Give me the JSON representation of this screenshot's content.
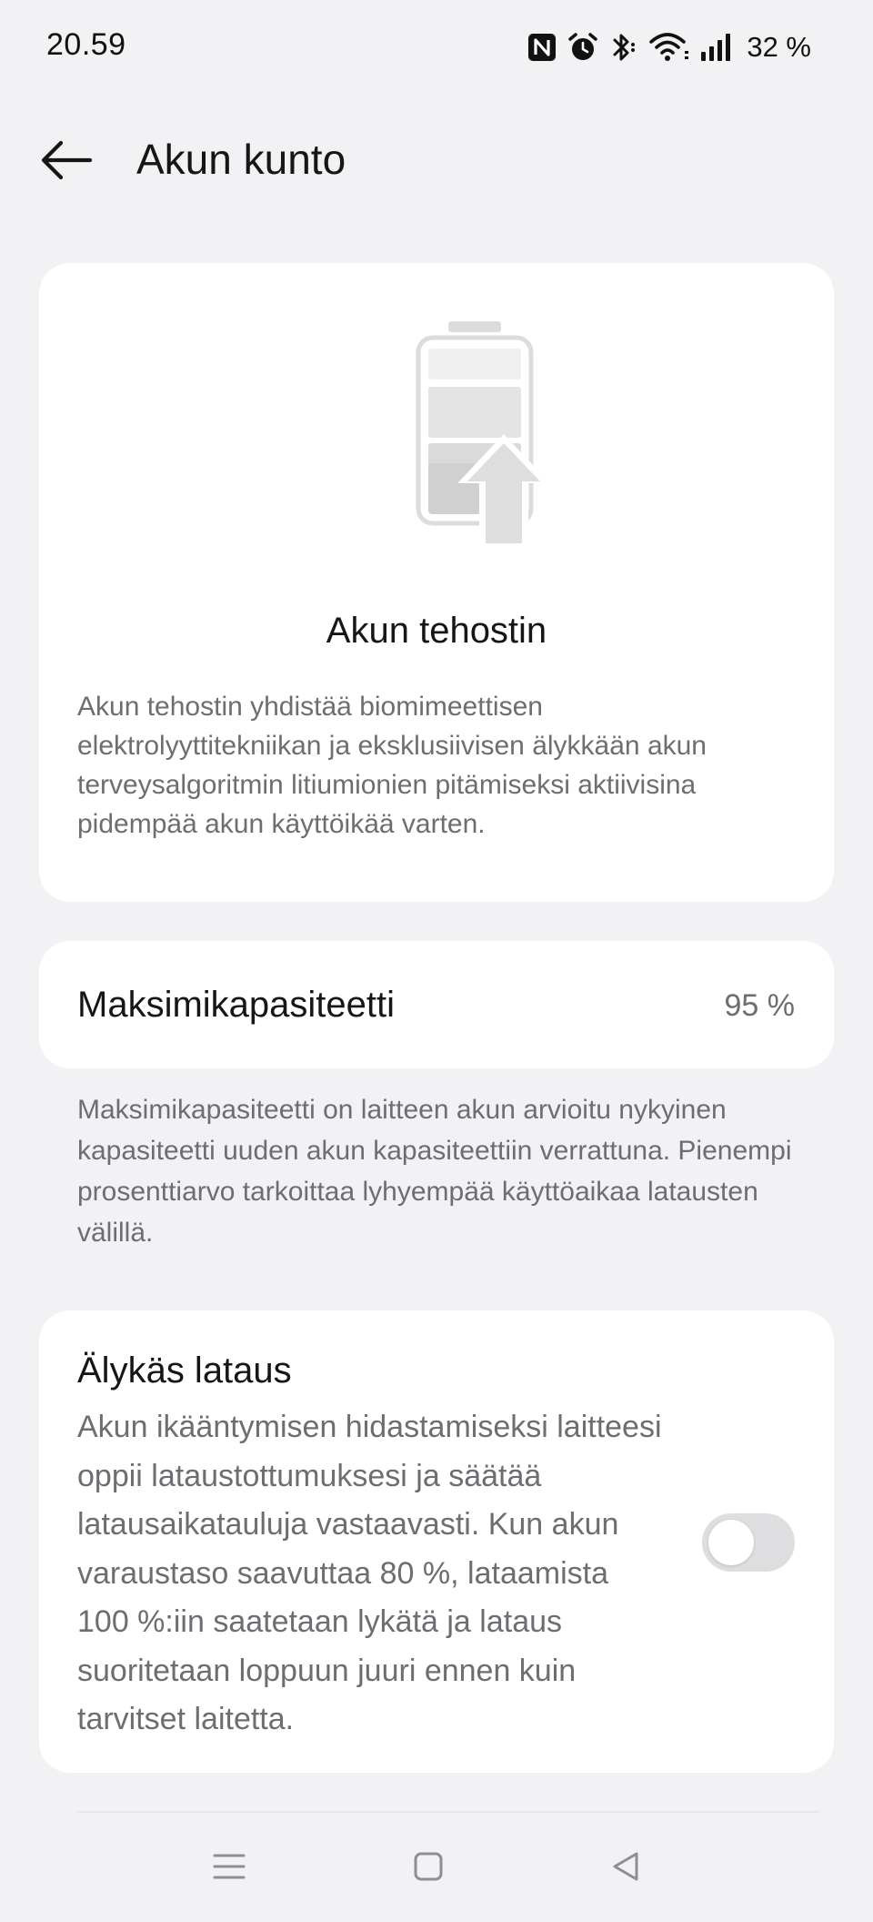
{
  "status_bar": {
    "time": "20.59",
    "battery_percent": "32 %",
    "icons": [
      "nfc-icon",
      "alarm-icon",
      "bluetooth-icon",
      "wifi-icon",
      "signal-icon"
    ]
  },
  "app_bar": {
    "title": "Akun kunto",
    "back_icon": "arrow-left-icon"
  },
  "booster_card": {
    "illustration_icon": "battery-boost-icon",
    "title": "Akun tehostin",
    "description": "Akun tehostin yhdistää biomimeettisen elektrolyyttitekniikan ja eksklusiivisen älykkään akun terveysalgoritmin litiumionien pitämiseksi aktiivisina pidempää akun käyttöikää varten."
  },
  "capacity": {
    "label": "Maksimikapasiteetti",
    "value": "95 %",
    "description": "Maksimikapasiteetti on laitteen akun arvioitu nykyinen kapasiteetti uuden akun kapasiteettiin verrattuna. Pienempi prosenttiarvo tarkoittaa lyhyempää käyttöaikaa latausten välillä."
  },
  "smart_charging": {
    "title": "Älykäs lataus",
    "description": "Akun ikääntymisen hidastamiseksi laitteesi oppii lataustottumuksesi ja säätää latausaikatauluja vastaavasti. Kun akun varaustaso saavuttaa 80 %, lataamista 100 %:iin saatetaan lykätä ja lataus suoritetaan loppuun juuri ennen kuin tarvitset laitetta.",
    "enabled": false
  },
  "nav_bar": {
    "icons": [
      "menu-icon",
      "home-icon",
      "back-icon"
    ]
  },
  "colors": {
    "background": "#f2f2f4",
    "card": "#ffffff",
    "secondary_text": "#6d6d72",
    "toggle_off": "#dedee0"
  }
}
